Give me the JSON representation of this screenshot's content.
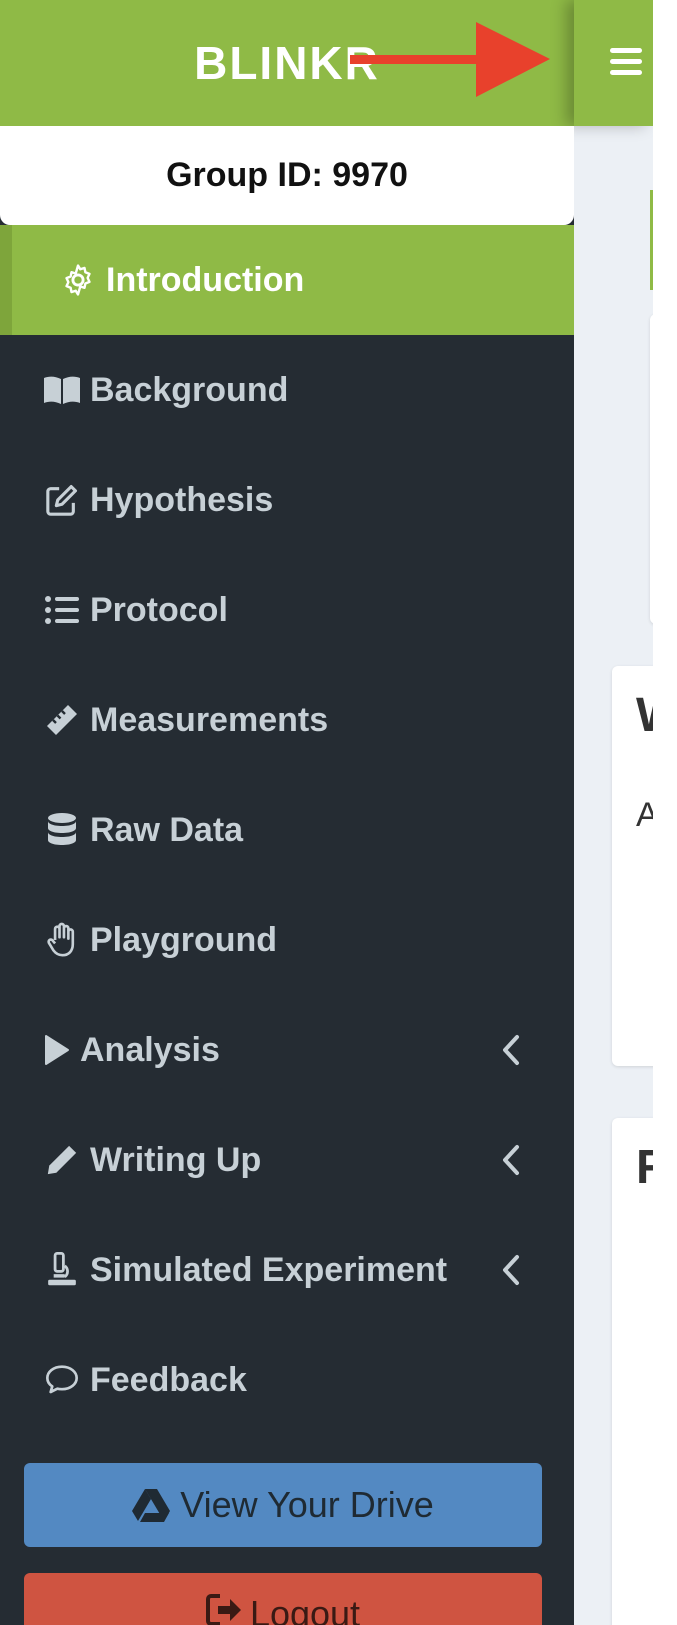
{
  "brand": {
    "title": "BLINKR"
  },
  "header": {
    "menu_icon": "hamburger-icon"
  },
  "group": {
    "label": "Group ID: 9970"
  },
  "sidebar": {
    "items": [
      {
        "label": "Introduction",
        "icon": "gear-icon",
        "active": true
      },
      {
        "label": "Background",
        "icon": "book-icon"
      },
      {
        "label": "Hypothesis",
        "icon": "edit-icon"
      },
      {
        "label": "Protocol",
        "icon": "list-icon"
      },
      {
        "label": "Measurements",
        "icon": "ruler-icon"
      },
      {
        "label": "Raw Data",
        "icon": "database-icon"
      },
      {
        "label": "Playground",
        "icon": "hand-icon"
      },
      {
        "label": "Analysis",
        "icon": "play-icon",
        "expandable": true
      },
      {
        "label": "Writing Up",
        "icon": "pencil-icon",
        "expandable": true
      },
      {
        "label": "Simulated Experiment",
        "icon": "microscope-icon",
        "expandable": true
      },
      {
        "label": "Feedback",
        "icon": "comment-icon"
      }
    ]
  },
  "buttons": {
    "drive_label": "View Your Drive",
    "logout_label": "Logout"
  },
  "content": {
    "card2_heading": "W",
    "card2_text": "A c",
    "card3_heading": "Re"
  },
  "colors": {
    "brand_green": "#8fba46",
    "sidebar_bg": "#252c33",
    "drive_blue": "#5389c2",
    "logout_red": "#cf5441",
    "annotation_arrow": "#e8412c"
  }
}
